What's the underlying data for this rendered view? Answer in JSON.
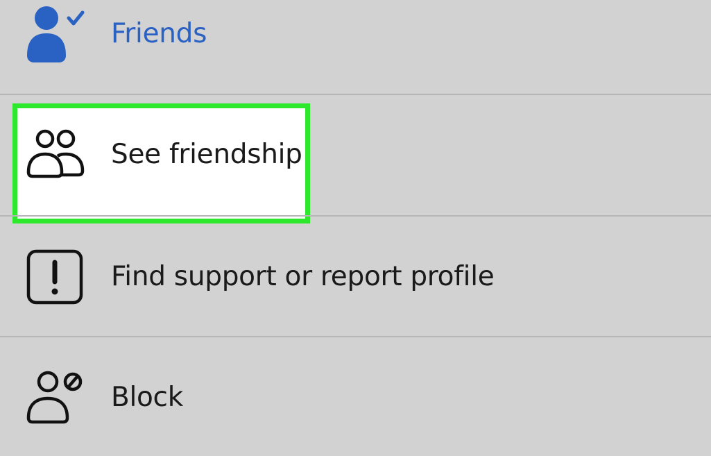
{
  "menu": {
    "items": [
      {
        "label": "Friends",
        "icon": "person-check-icon",
        "color": "#2a62c4"
      },
      {
        "label": "See friendship",
        "icon": "two-people-icon",
        "highlighted": true,
        "highlight_color": "#2ee82e"
      },
      {
        "label": "Find support or report profile",
        "icon": "exclamation-box-icon"
      },
      {
        "label": "Block",
        "icon": "person-block-icon"
      }
    ]
  }
}
